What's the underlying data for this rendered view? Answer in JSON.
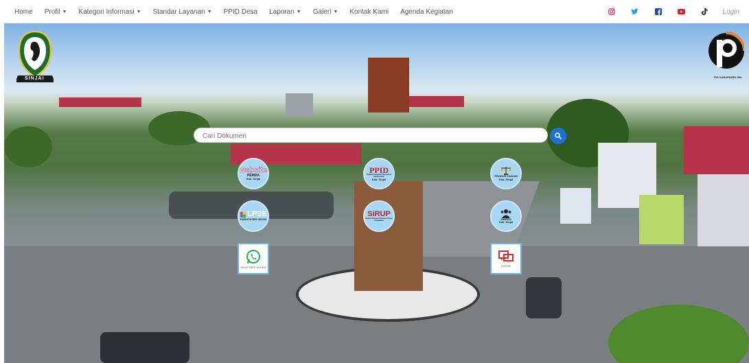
{
  "nav": {
    "items": [
      {
        "label": "Home",
        "dropdown": false
      },
      {
        "label": "Profil",
        "dropdown": true
      },
      {
        "label": "Kategori Informasi",
        "dropdown": true
      },
      {
        "label": "Standar Layanan",
        "dropdown": true
      },
      {
        "label": "PPID Desa",
        "dropdown": false
      },
      {
        "label": "Laporan",
        "dropdown": true
      },
      {
        "label": "Galeri",
        "dropdown": true
      },
      {
        "label": "Kontak Kami",
        "dropdown": false
      },
      {
        "label": "Agenda Kegiatan",
        "dropdown": false
      }
    ],
    "login": "Login",
    "social_icons": [
      "instagram-icon",
      "twitter-icon",
      "facebook-icon",
      "youtube-icon",
      "tiktok-icon"
    ]
  },
  "brand": {
    "left_logo_text": "SINJAI",
    "right_logo_caption": "PID KABUPATEN SIN"
  },
  "search": {
    "placeholder": "Cari Dokumen"
  },
  "links": {
    "website": {
      "big": "website",
      "sub1": "PEMDA",
      "sub2": "Kab. Sinjai"
    },
    "ppid": {
      "big": "PPID",
      "sub1": "Pejabat Pengelola Informasi & Dokumentasi",
      "sub2": "Kab. Sinjai"
    },
    "hukum": {
      "sub1": "PRODUK HUKUM",
      "sub2": "Kab. Sinjai"
    },
    "lpse": {
      "big": "LPSE",
      "sub1": "KABUPATEN SINJAI"
    },
    "sirup": {
      "big": "SiRUP",
      "sub1": "Sistem Informasi Rencana Umum Pengadaan"
    },
    "simpeg": {
      "sub1": "SIMPEG",
      "sub2": "Kab. Sinjai"
    },
    "whatsapp": {
      "sub1": "WHATSAPP ADUAN"
    },
    "lapor": {
      "sub1": "LAPOR!"
    }
  },
  "colors": {
    "accent": "#1b72d1",
    "circle_bg": "#a9d8f5"
  }
}
